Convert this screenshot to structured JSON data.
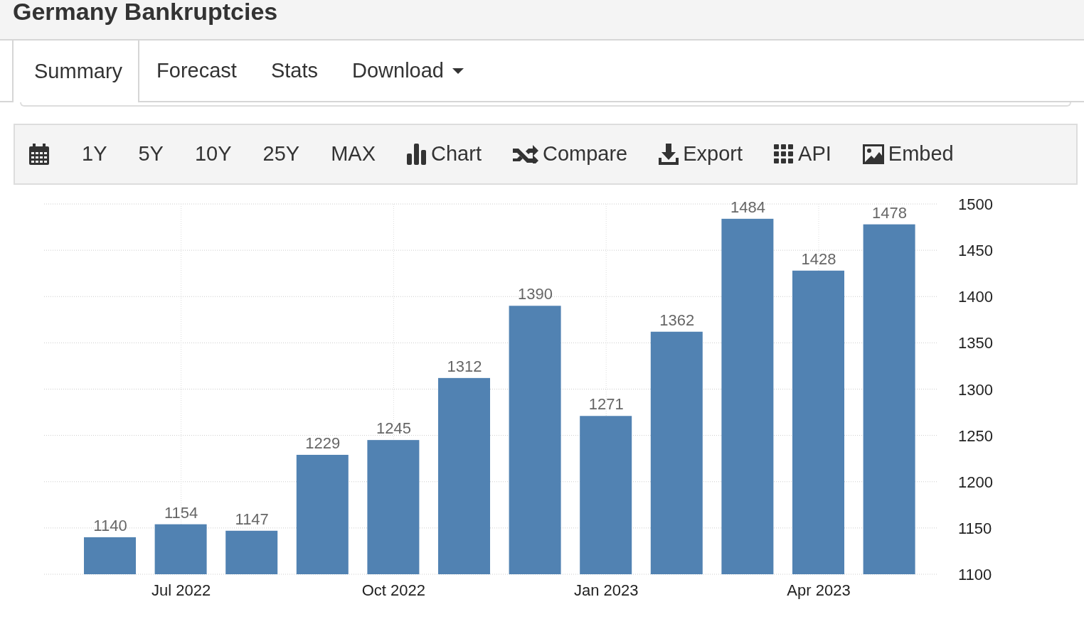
{
  "title": "Germany Bankruptcies",
  "tabs": [
    {
      "label": "Summary",
      "selected": true,
      "kind": "tab"
    },
    {
      "label": "Forecast",
      "selected": false,
      "kind": "tab"
    },
    {
      "label": "Stats",
      "selected": false,
      "kind": "tab"
    },
    {
      "label": "Download",
      "selected": false,
      "kind": "dropdown"
    }
  ],
  "toolbar": [
    {
      "kind": "calendar"
    },
    {
      "kind": "range",
      "label": "1Y"
    },
    {
      "kind": "range",
      "label": "5Y"
    },
    {
      "kind": "range",
      "label": "10Y"
    },
    {
      "kind": "range",
      "label": "25Y"
    },
    {
      "kind": "range",
      "label": "MAX"
    },
    {
      "kind": "chart",
      "label": "Chart"
    },
    {
      "kind": "compare",
      "label": "Compare"
    },
    {
      "kind": "export",
      "label": "Export"
    },
    {
      "kind": "api",
      "label": "API"
    },
    {
      "kind": "embed",
      "label": "Embed"
    }
  ],
  "chart_data": {
    "type": "bar",
    "categories": [
      null,
      "Jul 2022",
      null,
      null,
      "Oct 2022",
      null,
      null,
      "Jan 2023",
      null,
      null,
      "Apr 2023",
      null
    ],
    "values": [
      1140,
      1154,
      1147,
      1229,
      1245,
      1312,
      1390,
      1271,
      1362,
      1484,
      1428,
      1478
    ],
    "ylim": [
      1100,
      1500
    ],
    "yticks": [
      1100,
      1150,
      1200,
      1250,
      1300,
      1350,
      1400,
      1450,
      1500
    ],
    "data_labels": true,
    "grid": true
  }
}
